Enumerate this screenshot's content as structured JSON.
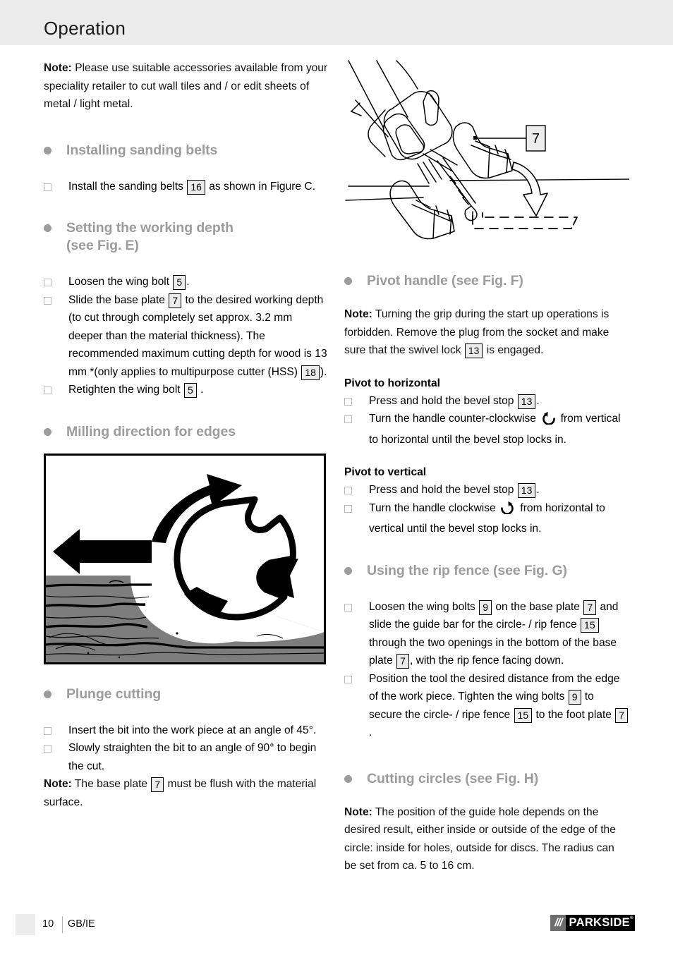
{
  "header": {
    "title": "Operation"
  },
  "left": {
    "intro_note": {
      "lead": "Note:",
      "body": " Please use suitable accessories available from your speciality retailer to cut wall tiles and / or edit sheets of metal / light metal."
    },
    "sections": [
      {
        "title": "Installing sanding belts",
        "items": [
          {
            "pre": "Install the sanding belts ",
            "ref": "16",
            "post": " as shown in Figure C."
          }
        ]
      },
      {
        "title": "Setting the working depth (see Fig. E)",
        "title_line1": "Setting the working depth",
        "title_line2": "(see Fig. E)",
        "items": [
          {
            "pre": "Loosen the wing bolt ",
            "ref": "5",
            "post": "."
          },
          {
            "pre": "Slide the base plate ",
            "ref": "7",
            "mid": " to the desired working depth (to cut through completely set approx. 3.2 mm deeper than the material thickness). The recommended maximum cutting depth for wood is 13 mm *(only applies to multipurpose cutter (HSS) ",
            "ref2": "18",
            "post": ")."
          },
          {
            "pre": "Retighten the wing bolt ",
            "ref": "5",
            "post": " ."
          }
        ]
      },
      {
        "title": "Milling direction for edges",
        "figure_name": "milling-direction-figure"
      },
      {
        "title": "Plunge cutting",
        "items": [
          {
            "pre": "Insert the bit into the work piece at an angle of 45°.",
            "ref": "",
            "post": ""
          },
          {
            "pre": "Slowly straighten the bit to an angle of 90° to begin the cut.",
            "ref": "",
            "post": ""
          }
        ],
        "note": {
          "lead": "Note:",
          "pre": " The base plate ",
          "ref": "7",
          "post": " must be flush with the material surface."
        }
      }
    ]
  },
  "right": {
    "figure": {
      "name": "pivot-handle-figure",
      "callout": "7"
    },
    "pivot_handle": {
      "title": "Pivot handle (see Fig. F)",
      "note": {
        "lead": "Note:",
        "pre": " Turning the grip during the start up operations is forbidden. Remove the plug from the socket and make sure that the swivel lock ",
        "ref": "13",
        "post": " is engaged."
      },
      "horizontal": {
        "subhead": "Pivot to horizontal",
        "items": [
          {
            "pre": "Press and hold the bevel stop ",
            "ref": "13",
            "post": "."
          },
          {
            "pre": "Turn the handle counter-clockwise ",
            "icon": "rotate-counter-clockwise-icon",
            "post": " from vertical to horizontal until the bevel stop locks in."
          }
        ]
      },
      "vertical": {
        "subhead": "Pivot to vertical",
        "items": [
          {
            "pre": "Press and hold the bevel stop ",
            "ref": "13",
            "post": "."
          },
          {
            "pre": "Turn the handle clockwise ",
            "icon": "rotate-clockwise-icon",
            "post": " from horizontal to vertical until the bevel stop locks in."
          }
        ]
      }
    },
    "rip_fence": {
      "title": "Using the rip fence (see Fig. G)",
      "items": [
        {
          "p1": "Loosen the wing bolts ",
          "r1": "9",
          "p2": " on the base plate ",
          "r2": "7",
          "p3": " and slide the guide bar for the circle- / rip fence ",
          "r3": "15",
          "p4": " through the two openings in the bottom of the base plate ",
          "r4": "7",
          "p5": ", with the rip fence facing down."
        },
        {
          "p1": "Position the tool the desired distance from the edge of the work piece. Tighten the wing bolts ",
          "r1": "9",
          "p2": " to secure the circle- / ripe fence ",
          "r2": "15",
          "p3": " to the foot plate ",
          "r3": "7",
          "p4": " .",
          "r4": "",
          "p5": ""
        }
      ]
    },
    "cutting_circles": {
      "title": "Cutting circles (see Fig. H)",
      "note": {
        "lead": "Note:",
        "body": " The position of the guide hole depends on the desired result, either inside or outside of the edge of the circle: inside for holes, outside for discs. The radius can be set from ca. 5 to 16 cm."
      }
    }
  },
  "footer": {
    "page": "10",
    "lang": "GB/IE",
    "logo_slashes": "///",
    "logo_word": "PARKSIDE",
    "logo_mark": "®"
  },
  "colors": {
    "header_band": "#ececec",
    "heading_gray": "#9c9c9c",
    "ref_fill": "#ececec",
    "wood_gray": "#7d7d7d",
    "logo_black": "#000000",
    "logo_gray": "#6e6e6e"
  }
}
